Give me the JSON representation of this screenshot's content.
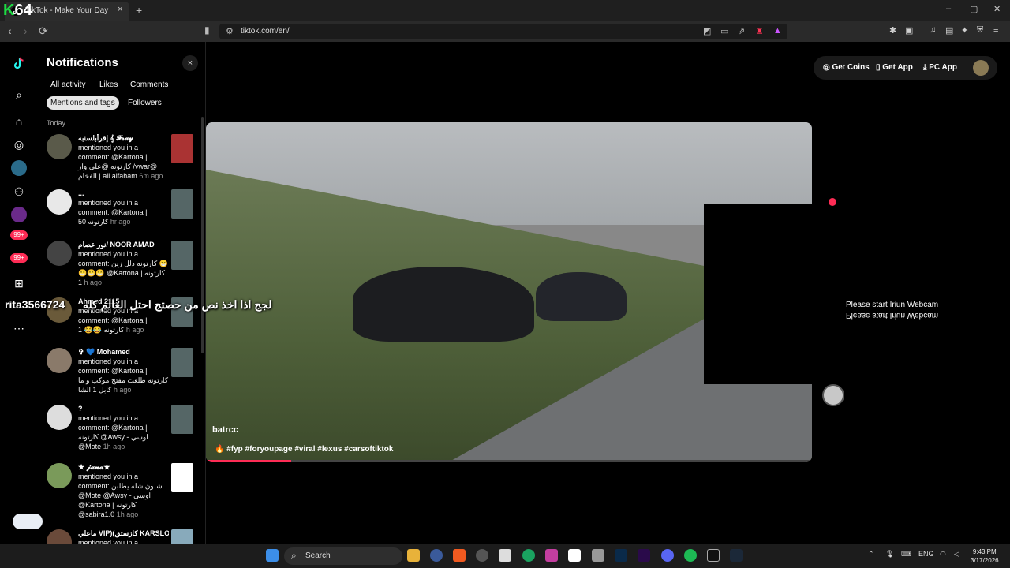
{
  "browser": {
    "tab_title": "TikTok - Make Your Day",
    "tab_close": "×",
    "new_tab": "+",
    "url": "tiktok.com/en/",
    "overlay_logo": "64",
    "overlay_logo_k": "K"
  },
  "window_controls": {
    "minimize": "–",
    "maximize": "▢",
    "close": "✕"
  },
  "nav": {
    "back": "‹",
    "forward": "›",
    "reload": "⟳"
  },
  "notifications": {
    "title": "Notifications",
    "close": "×",
    "tabs": [
      "All activity",
      "Likes",
      "Comments",
      "Mentions and tags",
      "Followers"
    ],
    "active_tab": "Mentions and tags",
    "section": "Today",
    "items": [
      {
        "name": "إقرأبلسنبه 𝄞 𝓕𝓻𝓪𝔂",
        "body": "mentioned you in a comment: @Kartona | كارتونه @علي وار /vwar@ الفخام | ali alfaham",
        "time": "6m ago",
        "avatar_color": "#5a5a4a",
        "thumb_color": "#a33"
      },
      {
        "name": "...",
        "body": "mentioned you in a comment: @Kartona | كارتونه 50",
        "time": "hr ago",
        "avatar_color": "#e8e8e8",
        "thumb_color": "#566"
      },
      {
        "name": "نور عصام/ NOOR AMAD",
        "body": "mentioned you in a comment: كارتونه دلل زين 😁😁😁😁 @Kartona | كارتونه 1",
        "time": "h ago",
        "avatar_color": "#444",
        "thumb_color": "#566"
      },
      {
        "name": "Ahmed 2115",
        "body": "mentioned you in a comment: @Kartona | كارتونه 😂😂 1",
        "time": "h ago",
        "avatar_color": "#6a5a3a",
        "thumb_color": "#566"
      },
      {
        "name": "✞ 💙 Mohamed",
        "body": "mentioned you in a comment: @Kartona | كارتونه طلعت مفتح موكب و ما كابل 1 الشا",
        "time": "h ago",
        "avatar_color": "#8a7a6a",
        "thumb_color": "#566"
      },
      {
        "name": "?",
        "body": "mentioned you in a comment: @Kartona | كارتونه @Awsy - اوسي @Mote",
        "time": "1h ago",
        "avatar_color": "#ddd",
        "thumb_color": "#566"
      },
      {
        "name": "★ 𝓳𝓪𝓷𝓪★",
        "body": "mentioned you in a comment: شلون شله يطلبن @Mote @Awsy - اوسي @Kartona | كارتونه @sabira1.0",
        "time": "1h ago",
        "avatar_color": "#7a9a5a",
        "thumb_color": "#fff"
      },
      {
        "name": "ماعلي VIP)(كازستق KARSLO)",
        "body": "mentioned you in a",
        "time": "",
        "avatar_color": "#6a4a3a",
        "thumb_color": "#8ab"
      }
    ]
  },
  "top_buttons": {
    "coins": "Get Coins",
    "app": "Get App",
    "pc": "PC App"
  },
  "video": {
    "author": "batrcc",
    "caption": "🔥 #fyp #foryoupage #viral #lexus #carsoftiktok",
    "progress": 0.14
  },
  "webcam": {
    "line1": "Please start Iriun Webcam",
    "line2": "Please start Iriun Webcam"
  },
  "overlay": {
    "username": "rita3566724",
    "arabic": "لجج اذا اخذ نص من حصتج احتل العالم كله"
  },
  "taskbar": {
    "search": "Search",
    "lang": "ENG",
    "time": "9:43 PM",
    "date": "3/17/2026",
    "badges": {
      "rail1": "99+",
      "rail2": "99+"
    }
  }
}
